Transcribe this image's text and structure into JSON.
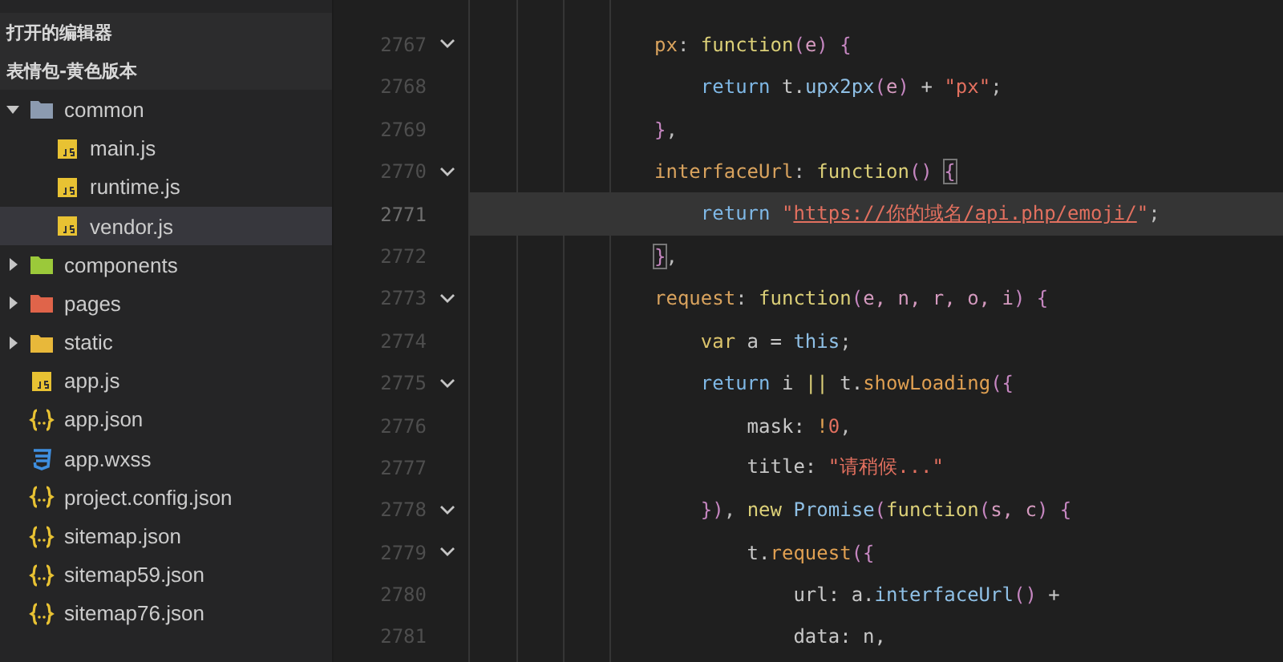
{
  "sidebar": {
    "sections": [
      {
        "label": "打开的编辑器"
      },
      {
        "label": "表情包-黄色版本"
      }
    ],
    "tree": [
      {
        "label": "common",
        "kind": "folder",
        "color": "#8c9bb0",
        "expanded": true,
        "selected": false,
        "children": [
          {
            "label": "main.js",
            "kind": "js",
            "selected": false
          },
          {
            "label": "runtime.js",
            "kind": "js",
            "selected": false
          },
          {
            "label": "vendor.js",
            "kind": "js",
            "selected": true
          }
        ]
      },
      {
        "label": "components",
        "kind": "folder",
        "color": "#9bc93a",
        "expanded": false,
        "selected": false
      },
      {
        "label": "pages",
        "kind": "folder",
        "color": "#e0644a",
        "expanded": false,
        "selected": false
      },
      {
        "label": "static",
        "kind": "folder",
        "color": "#e8b83a",
        "expanded": false,
        "selected": false
      },
      {
        "label": "app.js",
        "kind": "js",
        "selected": false
      },
      {
        "label": "app.json",
        "kind": "json",
        "selected": false
      },
      {
        "label": "app.wxss",
        "kind": "css",
        "selected": false
      },
      {
        "label": "project.config.json",
        "kind": "json",
        "selected": false
      },
      {
        "label": "sitemap.json",
        "kind": "json",
        "selected": false
      },
      {
        "label": "sitemap59.json",
        "kind": "json",
        "selected": false
      },
      {
        "label": "sitemap76.json",
        "kind": "json",
        "selected": false
      }
    ]
  },
  "editor": {
    "lines": [
      {
        "number": "2767",
        "foldable": true,
        "current": false,
        "tokens": [
          {
            "text": "px",
            "kind": "key"
          },
          {
            "text": ": ",
            "kind": "punc"
          },
          {
            "text": "function",
            "kind": "fn"
          },
          {
            "text": "(",
            "kind": "paren"
          },
          {
            "text": "e",
            "kind": "param"
          },
          {
            "text": ") {",
            "kind": "paren"
          }
        ]
      },
      {
        "number": "2768",
        "foldable": false,
        "current": false,
        "tokens": [
          {
            "text": "    return",
            "kind": "kw"
          },
          {
            "text": " t.",
            "kind": "plain"
          },
          {
            "text": "upx2px",
            "kind": "builtin"
          },
          {
            "text": "(",
            "kind": "paren"
          },
          {
            "text": "e",
            "kind": "param"
          },
          {
            "text": ")",
            "kind": "paren"
          },
          {
            "text": " + ",
            "kind": "plain"
          },
          {
            "text": "\"px\"",
            "kind": "str"
          },
          {
            "text": ";",
            "kind": "punc"
          }
        ]
      },
      {
        "number": "2769",
        "foldable": false,
        "current": false,
        "tokens": [
          {
            "text": "}",
            "kind": "paren"
          },
          {
            "text": ",",
            "kind": "punc"
          }
        ]
      },
      {
        "number": "2770",
        "foldable": true,
        "current": false,
        "tokens": [
          {
            "text": "interfaceUrl",
            "kind": "key"
          },
          {
            "text": ": ",
            "kind": "punc"
          },
          {
            "text": "function",
            "kind": "fn"
          },
          {
            "text": "() ",
            "kind": "paren"
          },
          {
            "text": "{",
            "kind": "match"
          }
        ]
      },
      {
        "number": "2771",
        "foldable": false,
        "current": true,
        "tokens": [
          {
            "text": "    return",
            "kind": "kw"
          },
          {
            "text": " \"",
            "kind": "str"
          },
          {
            "text": "https://你的域名/api.php/emoji/",
            "kind": "link"
          },
          {
            "text": "\"",
            "kind": "str"
          },
          {
            "text": ";",
            "kind": "punc"
          }
        ]
      },
      {
        "number": "2772",
        "foldable": false,
        "current": false,
        "tokens": [
          {
            "text": "}",
            "kind": "match"
          },
          {
            "text": ",",
            "kind": "punc"
          }
        ]
      },
      {
        "number": "2773",
        "foldable": true,
        "current": false,
        "tokens": [
          {
            "text": "request",
            "kind": "key"
          },
          {
            "text": ": ",
            "kind": "punc"
          },
          {
            "text": "function",
            "kind": "fn"
          },
          {
            "text": "(",
            "kind": "paren"
          },
          {
            "text": "e, n, r, o, i",
            "kind": "param"
          },
          {
            "text": ") {",
            "kind": "paren"
          }
        ]
      },
      {
        "number": "2774",
        "foldable": false,
        "current": false,
        "tokens": [
          {
            "text": "    var",
            "kind": "var"
          },
          {
            "text": " a = ",
            "kind": "plain"
          },
          {
            "text": "this",
            "kind": "builtin"
          },
          {
            "text": ";",
            "kind": "punc"
          }
        ]
      },
      {
        "number": "2775",
        "foldable": true,
        "current": false,
        "tokens": [
          {
            "text": "    return",
            "kind": "kw"
          },
          {
            "text": " i ",
            "kind": "plain"
          },
          {
            "text": "||",
            "kind": "fn"
          },
          {
            "text": " t.",
            "kind": "plain"
          },
          {
            "text": "showLoading",
            "kind": "method"
          },
          {
            "text": "({",
            "kind": "paren"
          }
        ]
      },
      {
        "number": "2776",
        "foldable": false,
        "current": false,
        "tokens": [
          {
            "text": "        mask: ",
            "kind": "plain"
          },
          {
            "text": "!",
            "kind": "method"
          },
          {
            "text": "0",
            "kind": "num"
          },
          {
            "text": ",",
            "kind": "punc"
          }
        ]
      },
      {
        "number": "2777",
        "foldable": false,
        "current": false,
        "tokens": [
          {
            "text": "        title: ",
            "kind": "plain"
          },
          {
            "text": "\"请稍候...\"",
            "kind": "str"
          }
        ]
      },
      {
        "number": "2778",
        "foldable": true,
        "current": false,
        "tokens": [
          {
            "text": "    })",
            "kind": "paren"
          },
          {
            "text": ", ",
            "kind": "punc"
          },
          {
            "text": "new",
            "kind": "fn"
          },
          {
            "text": " Promise",
            "kind": "builtin"
          },
          {
            "text": "(",
            "kind": "paren"
          },
          {
            "text": "function",
            "kind": "fn"
          },
          {
            "text": "(",
            "kind": "paren"
          },
          {
            "text": "s, c",
            "kind": "param"
          },
          {
            "text": ") {",
            "kind": "paren"
          }
        ]
      },
      {
        "number": "2779",
        "foldable": true,
        "current": false,
        "tokens": [
          {
            "text": "        t.",
            "kind": "plain"
          },
          {
            "text": "request",
            "kind": "method"
          },
          {
            "text": "({",
            "kind": "paren"
          }
        ]
      },
      {
        "number": "2780",
        "foldable": false,
        "current": false,
        "tokens": [
          {
            "text": "            url: a.",
            "kind": "plain"
          },
          {
            "text": "interfaceUrl",
            "kind": "builtin"
          },
          {
            "text": "()",
            "kind": "paren"
          },
          {
            "text": " +",
            "kind": "plain"
          }
        ]
      },
      {
        "number": "2781",
        "foldable": false,
        "current": false,
        "tokens": [
          {
            "text": "            data: n,",
            "kind": "plain"
          }
        ]
      }
    ]
  }
}
